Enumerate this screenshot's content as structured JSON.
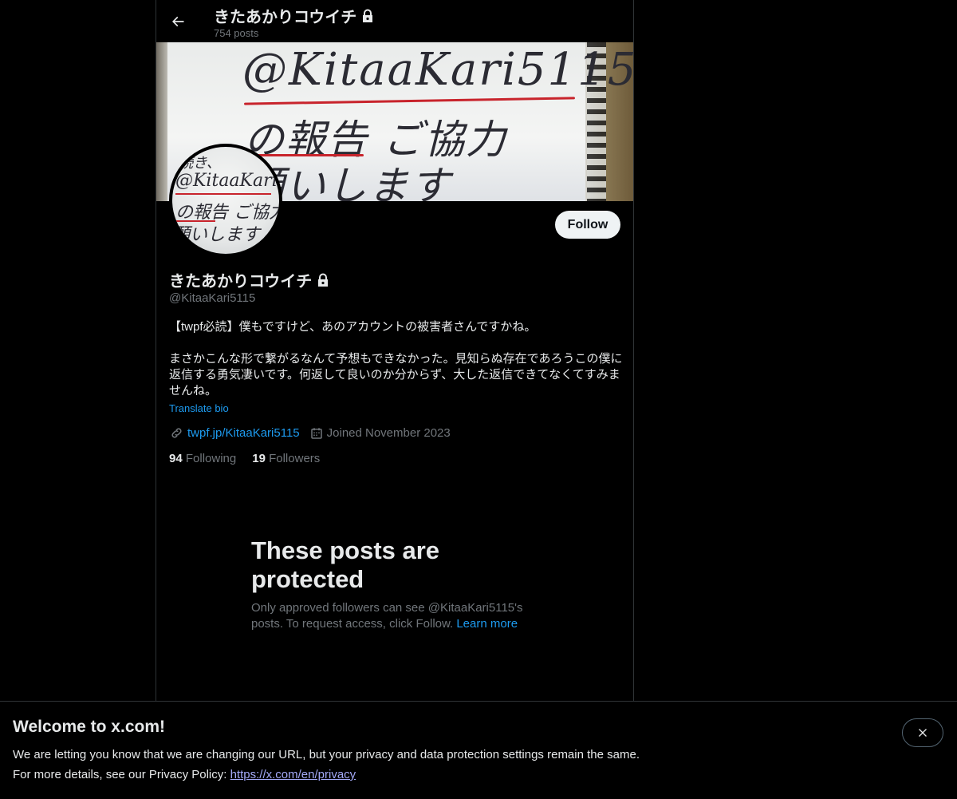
{
  "header": {
    "title": "きたあかりコウイチ",
    "posts_count": "754 posts"
  },
  "banner": {
    "text_line1": "@KitaaKari5115",
    "text_line2": "の報告 ご協力",
    "text_line3": "願いします"
  },
  "avatar": {
    "line0": "続き、",
    "line1": "@KitaaKari",
    "line2": "の報告 ご協力",
    "line3": "願いします"
  },
  "profile": {
    "follow_label": "Follow",
    "name": "きたあかりコウイチ",
    "handle": "@KitaaKari5115",
    "bio": "【twpf必読】僕もですけど、あのアカウントの被害者さんですかね。\n\nまさかこんな形で繋がるなんて予想もできなかった。見知らぬ存在であろうこの僕に返信する勇気凄いです。何返して良いのか分からず、大した返信できてなくてすみませんね。",
    "translate_label": "Translate bio",
    "website": "twpf.jp/KitaaKari5115",
    "joined": "Joined November 2023",
    "following_count": "94",
    "following_label": "Following",
    "followers_count": "19",
    "followers_label": "Followers"
  },
  "protected": {
    "title": "These posts are protected",
    "body": "Only approved followers can see @KitaaKari5115's posts. To request access, click Follow.",
    "learn_more": "Learn more"
  },
  "bottom_banner": {
    "title": "Welcome to x.com!",
    "line1": "We are letting you know that we are changing our URL, but your privacy and data protection settings remain the same.",
    "line2_prefix": "For more details, see our Privacy Policy:",
    "privacy_link": "https://x.com/en/privacy"
  },
  "colors": {
    "background": "#000000",
    "text_primary": "#e7e9ea",
    "text_secondary": "#71767b",
    "link": "#1d9bf0",
    "follow_button_bg": "#eff3f4",
    "border": "#2f3336"
  },
  "icons": {
    "back": "arrow-left-icon",
    "lock": "lock-icon",
    "link": "link-icon",
    "calendar": "calendar-icon",
    "close": "close-icon"
  }
}
